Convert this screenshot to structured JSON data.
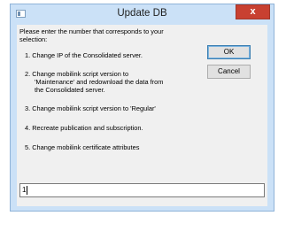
{
  "window": {
    "title": "Update DB",
    "close_label": "x"
  },
  "prompt": {
    "line1": "Please enter the number that corresponds to your",
    "line2": "selection:"
  },
  "options": [
    {
      "lines": [
        "1. Change IP of the Consolidated server."
      ]
    },
    {
      "lines": [
        "2. Change mobilink script version to",
        "'Maintenance' and redownload the data from",
        "the Consolidated server."
      ]
    },
    {
      "lines": [
        "3. Change mobilink script version to 'Regular'"
      ]
    },
    {
      "lines": [
        "4. Recreate publication and subscription."
      ]
    },
    {
      "lines": [
        "5. Change mobilink certificate attributes"
      ]
    }
  ],
  "buttons": {
    "ok_label": "OK",
    "cancel_label": "Cancel"
  },
  "input": {
    "value": "1"
  }
}
